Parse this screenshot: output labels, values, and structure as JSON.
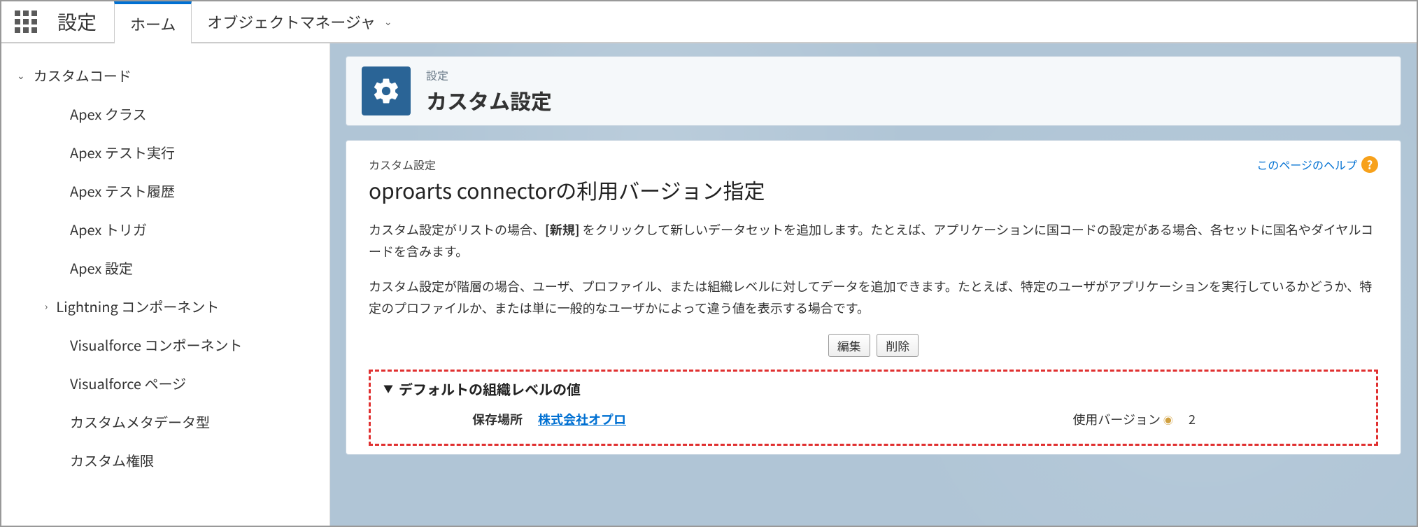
{
  "topbar": {
    "app_name": "設定",
    "tabs": [
      {
        "label": "ホーム",
        "active": true
      },
      {
        "label": "オブジェクトマネージャ",
        "has_menu": true
      }
    ]
  },
  "sidebar": {
    "section_label": "カスタムコード",
    "items": [
      "Apex クラス",
      "Apex テスト実行",
      "Apex テスト履歴",
      "Apex トリガ",
      "Apex 設定"
    ],
    "sub_section": "Lightning コンポーネント",
    "items2": [
      "Visualforce コンポーネント",
      "Visualforce ページ",
      "カスタムメタデータ型",
      "カスタム権限"
    ]
  },
  "header": {
    "crumb": "設定",
    "title": "カスタム設定"
  },
  "panel": {
    "crumb": "カスタム設定",
    "title": "oproarts connectorの利用バージョン指定",
    "help_label": "このページのヘルプ",
    "desc1_pre": "カスタム設定がリストの場合、",
    "desc1_bold": "[新規]",
    "desc1_post": " をクリックして新しいデータセットを追加します。たとえば、アプリケーションに国コードの設定がある場合、各セットに国名やダイヤルコードを含みます。",
    "desc2": "カスタム設定が階層の場合、ユーザ、プロファイル、または組織レベルに対してデータを追加できます。たとえば、特定のユーザがアプリケーションを実行しているかどうか、特定のプロファイルか、または単に一般的なユーザかによって違う値を表示する場合です。",
    "buttons": {
      "edit": "編集",
      "delete": "削除"
    },
    "section_title": "デフォルトの組織レベルの値",
    "detail": {
      "location_label": "保存場所",
      "location_value": "株式会社オプロ",
      "version_label": "使用バージョン",
      "version_value": "2"
    }
  }
}
